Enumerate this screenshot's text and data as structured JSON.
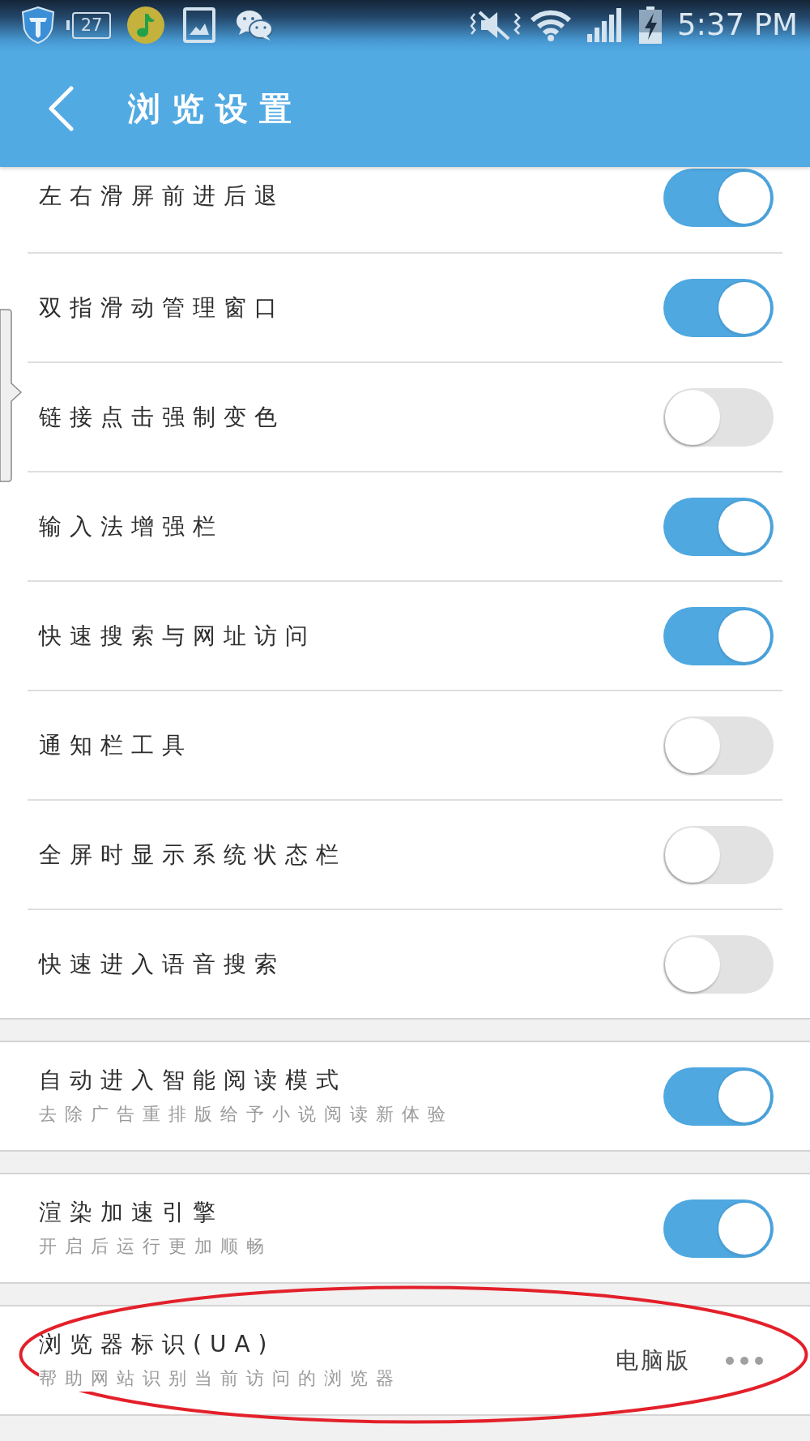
{
  "status_bar": {
    "notification_number": "27",
    "time": "5:37 PM"
  },
  "header": {
    "title": "浏览设置"
  },
  "sections": [
    {
      "circled": false,
      "items": [
        {
          "kind": "toggle",
          "label": "左右滑屏前进后退",
          "on": true
        },
        {
          "kind": "toggle",
          "label": "双指滑动管理窗口",
          "on": true
        },
        {
          "kind": "toggle",
          "label": "链接点击强制变色",
          "on": false
        },
        {
          "kind": "toggle",
          "label": "输入法增强栏",
          "on": true
        },
        {
          "kind": "toggle",
          "label": "快速搜索与网址访问",
          "on": true
        },
        {
          "kind": "toggle",
          "label": "通知栏工具",
          "on": false
        },
        {
          "kind": "toggle",
          "label": "全屏时显示系统状态栏",
          "on": false
        },
        {
          "kind": "toggle",
          "label": "快速进入语音搜索",
          "on": false
        }
      ]
    },
    {
      "circled": false,
      "items": [
        {
          "kind": "toggle",
          "label": "自动进入智能阅读模式",
          "description": "去除广告重排版给予小说阅读新体验",
          "on": true
        }
      ]
    },
    {
      "circled": false,
      "items": [
        {
          "kind": "toggle",
          "label": "渲染加速引擎",
          "description": "开启后运行更加顺畅",
          "on": true
        }
      ]
    },
    {
      "circled": true,
      "items": [
        {
          "kind": "choice",
          "label": "浏览器标识(UA)",
          "description": "帮助网站识别当前访问的浏览器",
          "value": "电脑版"
        }
      ]
    }
  ]
}
